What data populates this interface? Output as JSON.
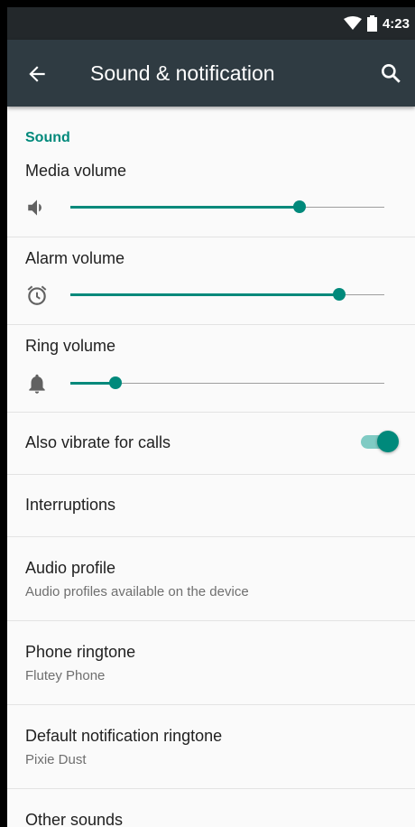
{
  "status_bar": {
    "time": "4:23",
    "icons": [
      "wifi-icon",
      "battery-icon"
    ]
  },
  "app_bar": {
    "title": "Sound & notification",
    "back_icon": "arrow-back-icon",
    "search_icon": "search-icon"
  },
  "colors": {
    "accent": "#00897b",
    "toolbar": "#2f3b42",
    "status_bar": "#23282b"
  },
  "sound_section": {
    "header": "Sound",
    "media_volume": {
      "label": "Media volume",
      "icon": "speaker-icon",
      "level": 0.73
    },
    "alarm_volume": {
      "label": "Alarm volume",
      "icon": "alarm-clock-icon",
      "level": 0.857
    },
    "ring_volume": {
      "label": "Ring volume",
      "icon": "bell-icon",
      "level": 0.144
    }
  },
  "settings": {
    "vibrate_for_calls": {
      "label": "Also vibrate for calls",
      "enabled": true
    },
    "interruptions": {
      "label": "Interruptions"
    },
    "audio_profile": {
      "label": "Audio profile",
      "summary": "Audio profiles available on the device"
    },
    "phone_ringtone": {
      "label": "Phone ringtone",
      "summary": "Flutey Phone"
    },
    "notification_ringtone": {
      "label": "Default notification ringtone",
      "summary": "Pixie Dust"
    },
    "other_sounds": {
      "label": "Other sounds"
    }
  }
}
